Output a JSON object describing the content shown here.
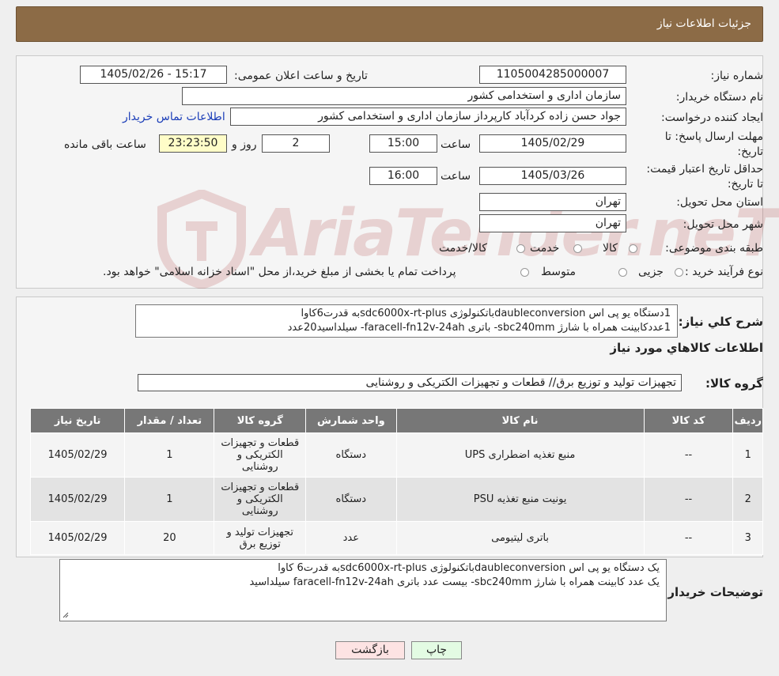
{
  "header": {
    "title": "جزئیات اطلاعات نیاز"
  },
  "form": {
    "need_number_label": "شماره نیاز:",
    "need_number": "1105004285000007",
    "announce_label": "تاریخ و ساعت اعلان عمومی:",
    "announce_value": "1405/02/26 - 15:17",
    "buyer_org_label": "نام دستگاه خریدار:",
    "buyer_org": "سازمان اداری و استخدامی کشور",
    "requester_label": "ایجاد کننده درخواست:",
    "requester": "جواد حسن زاده کردآباد کارپرداز سازمان اداری و استخدامی کشور",
    "contact_link": "اطلاعات تماس خریدار",
    "reply_deadline_label": "مهلت ارسال پاسخ: تا تاریخ:",
    "reply_date": "1405/02/29",
    "time_label": "ساعت",
    "reply_time": "15:00",
    "days_value": "2",
    "days_label": "روز و",
    "remaining_value": "23:23:50",
    "remaining_label": "ساعت باقی مانده",
    "price_validity_label": "حداقل تاریخ اعتبار قیمت: تا تاریخ:",
    "validity_date": "1405/03/26",
    "validity_time": "16:00",
    "province_label": "استان محل تحویل:",
    "province": "تهران",
    "city_label": "شهر محل تحویل:",
    "city": "تهران",
    "category_label": "طبقه بندی موضوعی:",
    "category_options": [
      "کالا",
      "خدمت",
      "کالا/خدمت"
    ],
    "process_label": "نوع فرآیند خرید :",
    "process_options": [
      "جزیی",
      "متوسط"
    ],
    "process_note": "پرداخت تمام یا بخشی از مبلغ خرید،از محل \"اسناد خزانه اسلامی\" خواهد بود."
  },
  "summary": {
    "label": "شرح کلي نياز:",
    "line1": "1دستگاه یو پی اس daubleconversionباتکنولوژی sdc6000x-rt-plusبه قدرت6کاوا",
    "line2": "1عددکابینت همراه با شارژ sbc240mm- باتری faracell-fn12v-24ah- سیلداسید20عدد"
  },
  "goods": {
    "section_title": "اطلاعات کالاهاي مورد نياز",
    "group_label": "گروه کالا:",
    "group_value": "تجهیزات تولید و توزیع برق// قطعات و تجهیزات الکتریکی و روشنایی",
    "columns": [
      "ردیف",
      "کد کالا",
      "نام کالا",
      "واحد شمارش",
      "گروه کالا",
      "تعداد / مقدار",
      "تاریخ نیاز"
    ],
    "rows": [
      {
        "idx": "1",
        "code": "--",
        "name": "منبع تغذیه اضطراری UPS",
        "unit": "دستگاه",
        "group": "قطعات و تجهیزات الکتریکی و روشنایی",
        "qty": "1",
        "date": "1405/02/29"
      },
      {
        "idx": "2",
        "code": "--",
        "name": "یونیت منبع تغذیه PSU",
        "unit": "دستگاه",
        "group": "قطعات و تجهیزات الکتریکی و روشنایی",
        "qty": "1",
        "date": "1405/02/29"
      },
      {
        "idx": "3",
        "code": "--",
        "name": "باتری لیتیومی",
        "unit": "عدد",
        "group": "تجهیزات تولید و توزیع برق",
        "qty": "20",
        "date": "1405/02/29"
      }
    ]
  },
  "buyer_notes": {
    "label": "توضیحات خریدار:",
    "line1": "یک دستگاه یو پی اس daubleconversionباتکنولوژی sdc6000x-rt-plusبه قدرت6 کاوا",
    "line2": "یک عدد کابینت همراه با شارژ sbc240mm- بیست عدد باتری faracell-fn12v-24ah سیلداسید"
  },
  "buttons": {
    "print": "چاپ",
    "back": "بازگشت"
  },
  "watermark": {
    "text": "AriaTender.neT"
  },
  "colors": {
    "header": "#8c6b46",
    "link": "#1a3db8",
    "back_button": "#fde3e3",
    "print_button": "#e3fbe3"
  }
}
